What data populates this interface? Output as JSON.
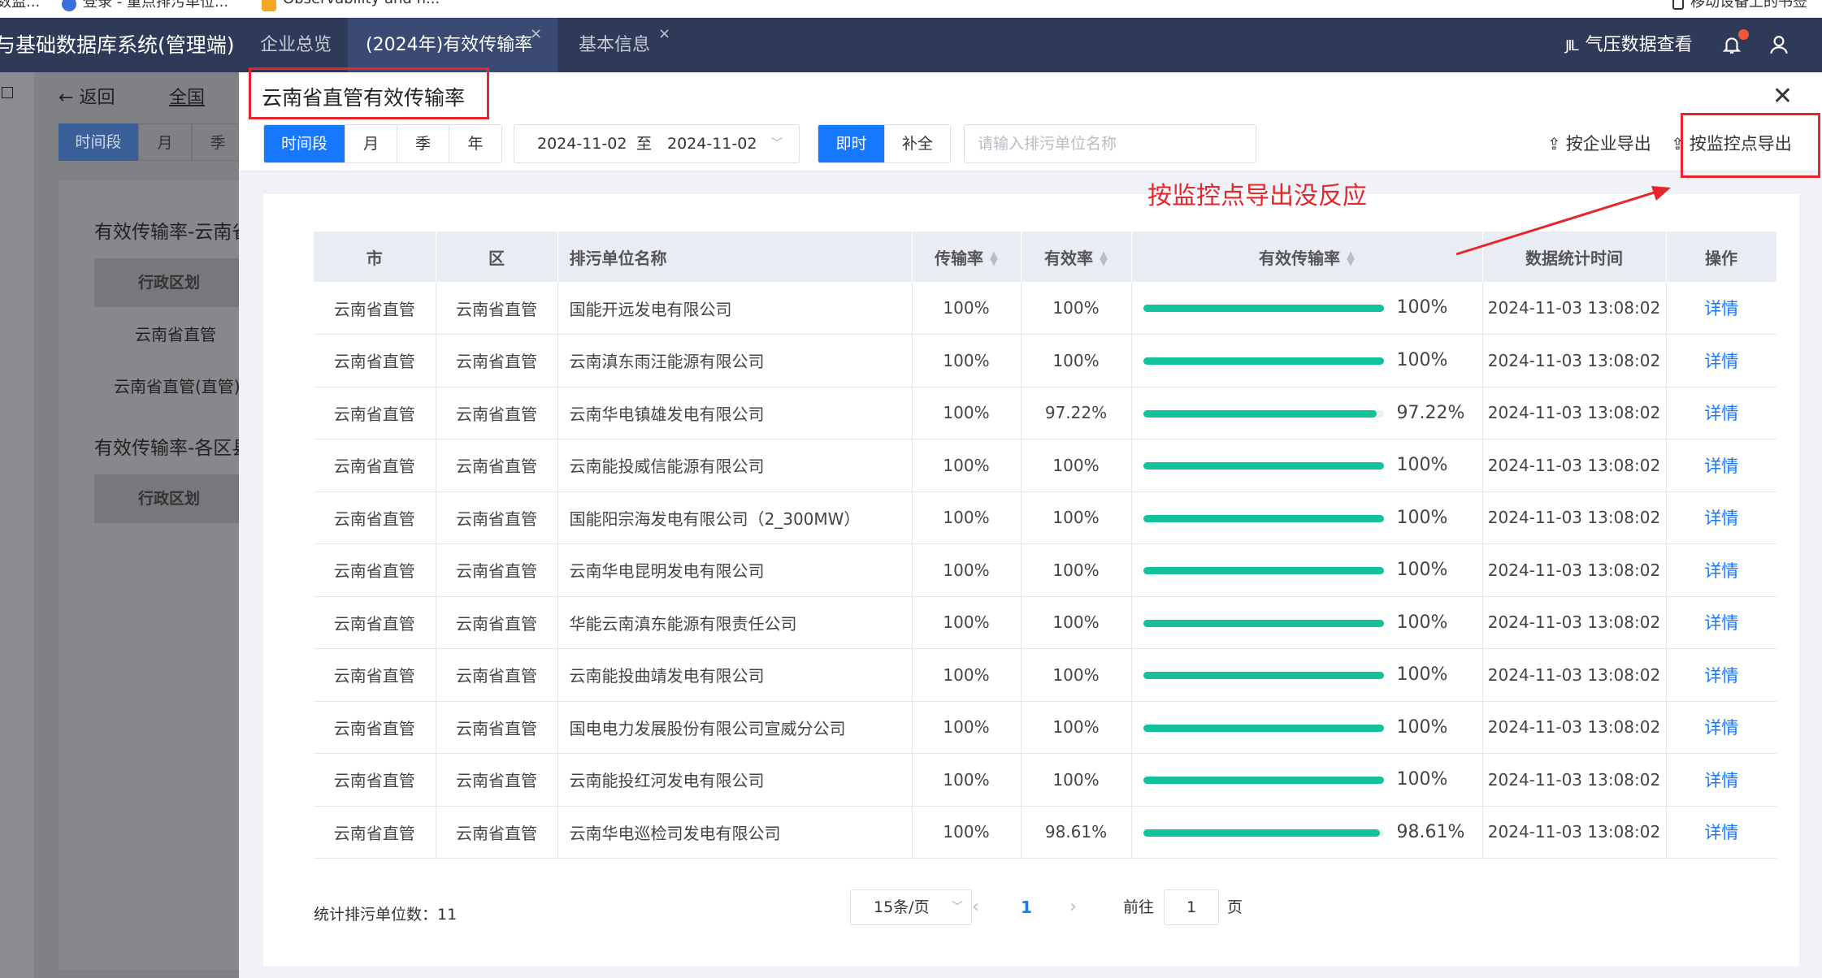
{
  "browser_bookmarks": [
    "数监...",
    "登录 - 重点排污单位...",
    "Observability and n...",
    "移动设备上的书签"
  ],
  "header": {
    "app_title": "与基础数据库系统(管理端)",
    "tabs": [
      {
        "label": "企业总览",
        "active": false,
        "closable": false
      },
      {
        "label": "(2024年)有效传输率",
        "active": true,
        "closable": true
      },
      {
        "label": "基本信息",
        "active": false,
        "closable": true
      }
    ],
    "close_glyph": "×",
    "pressure_label": "气压数据查看",
    "pressure_icon_glyph": "JIL"
  },
  "background_page": {
    "back_label": "返回",
    "breadcrumb": "全国",
    "period_tabs": [
      "时间段",
      "月",
      "季"
    ],
    "section1_title": "有效传输率-云南省",
    "col_header": "行政区划",
    "rows": [
      "云南省直管",
      "云南省直管(直管)"
    ],
    "section2_title": "有效传输率-各区县",
    "col_header2": "行政区划"
  },
  "modal": {
    "title": "云南省直管有效传输率",
    "close_glyph": "✕",
    "period_tabs": [
      {
        "label": "时间段",
        "active": true
      },
      {
        "label": "月",
        "active": false
      },
      {
        "label": "季",
        "active": false
      },
      {
        "label": "年",
        "active": false
      }
    ],
    "date_start": "2024-11-02",
    "date_sep": "至",
    "date_end": "2024-11-02",
    "mode_tabs": [
      {
        "label": "即时",
        "active": true
      },
      {
        "label": "补全",
        "active": false
      }
    ],
    "search_placeholder": "请输入排污单位名称",
    "export_company": "按企业导出",
    "export_point": "按监控点导出",
    "annotation": "按监控点导出没反应"
  },
  "table": {
    "columns": [
      "市",
      "区",
      "排污单位名称",
      "传输率",
      "有效率",
      "有效传输率",
      "数据统计时间",
      "操作"
    ],
    "rows": [
      {
        "city": "云南省直管",
        "district": "云南省直管",
        "name": "国能开远发电有限公司",
        "transmission": "100%",
        "validity": "100%",
        "effective": "100%",
        "effective_value": 100,
        "time": "2024-11-03 13:08:02",
        "action": "详情"
      },
      {
        "city": "云南省直管",
        "district": "云南省直管",
        "name": "云南滇东雨汪能源有限公司",
        "transmission": "100%",
        "validity": "100%",
        "effective": "100%",
        "effective_value": 100,
        "time": "2024-11-03 13:08:02",
        "action": "详情"
      },
      {
        "city": "云南省直管",
        "district": "云南省直管",
        "name": "云南华电镇雄发电有限公司",
        "transmission": "100%",
        "validity": "97.22%",
        "effective": "97.22%",
        "effective_value": 97.22,
        "time": "2024-11-03 13:08:02",
        "action": "详情"
      },
      {
        "city": "云南省直管",
        "district": "云南省直管",
        "name": "云南能投威信能源有限公司",
        "transmission": "100%",
        "validity": "100%",
        "effective": "100%",
        "effective_value": 100,
        "time": "2024-11-03 13:08:02",
        "action": "详情"
      },
      {
        "city": "云南省直管",
        "district": "云南省直管",
        "name": "国能阳宗海发电有限公司（2_300MW）",
        "transmission": "100%",
        "validity": "100%",
        "effective": "100%",
        "effective_value": 100,
        "time": "2024-11-03 13:08:02",
        "action": "详情"
      },
      {
        "city": "云南省直管",
        "district": "云南省直管",
        "name": "云南华电昆明发电有限公司",
        "transmission": "100%",
        "validity": "100%",
        "effective": "100%",
        "effective_value": 100,
        "time": "2024-11-03 13:08:02",
        "action": "详情"
      },
      {
        "city": "云南省直管",
        "district": "云南省直管",
        "name": "华能云南滇东能源有限责任公司",
        "transmission": "100%",
        "validity": "100%",
        "effective": "100%",
        "effective_value": 100,
        "time": "2024-11-03 13:08:02",
        "action": "详情"
      },
      {
        "city": "云南省直管",
        "district": "云南省直管",
        "name": "云南能投曲靖发电有限公司",
        "transmission": "100%",
        "validity": "100%",
        "effective": "100%",
        "effective_value": 100,
        "time": "2024-11-03 13:08:02",
        "action": "详情"
      },
      {
        "city": "云南省直管",
        "district": "云南省直管",
        "name": "国电电力发展股份有限公司宣威分公司",
        "transmission": "100%",
        "validity": "100%",
        "effective": "100%",
        "effective_value": 100,
        "time": "2024-11-03 13:08:02",
        "action": "详情"
      },
      {
        "city": "云南省直管",
        "district": "云南省直管",
        "name": "云南能投红河发电有限公司",
        "transmission": "100%",
        "validity": "100%",
        "effective": "100%",
        "effective_value": 100,
        "time": "2024-11-03 13:08:02",
        "action": "详情"
      },
      {
        "city": "云南省直管",
        "district": "云南省直管",
        "name": "云南华电巡检司发电有限公司",
        "transmission": "100%",
        "validity": "98.61%",
        "effective": "98.61%",
        "effective_value": 98.61,
        "time": "2024-11-03 13:08:02",
        "action": "详情"
      }
    ]
  },
  "footer": {
    "total_label": "统计排污单位数：11",
    "page_size": "15条/页",
    "current_page": "1",
    "goto_prefix": "前往",
    "goto_value": "1",
    "goto_suffix": "页"
  },
  "colors": {
    "header_bg": "#2f3a59",
    "accent": "#1677ff",
    "progress": "#13c29a",
    "annotation": "#e5262c"
  }
}
